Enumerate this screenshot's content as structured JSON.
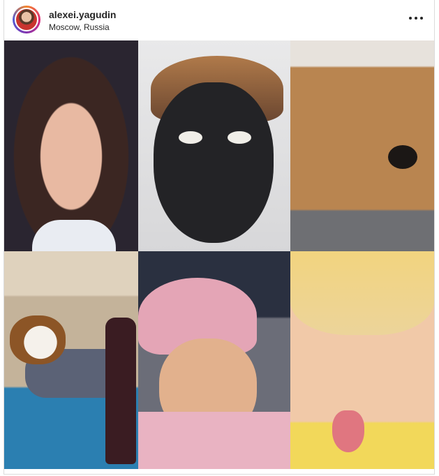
{
  "post": {
    "username": "alexei.yagudin",
    "location": "Moscow, Russia",
    "more_icon": "more-horizontal-icon"
  },
  "photos": [
    {
      "name": "photo-girl-crossed-eyes"
    },
    {
      "name": "photo-man-black-face-mask"
    },
    {
      "name": "photo-yorkshire-terrier"
    },
    {
      "name": "photo-beagle-with-bottle"
    },
    {
      "name": "photo-woman-pink-hat"
    },
    {
      "name": "photo-toddler-tongue-out"
    }
  ],
  "colors": {
    "text": "#262626",
    "border": "#dbdbdb",
    "avatar_ring": "#dd2a7b"
  }
}
